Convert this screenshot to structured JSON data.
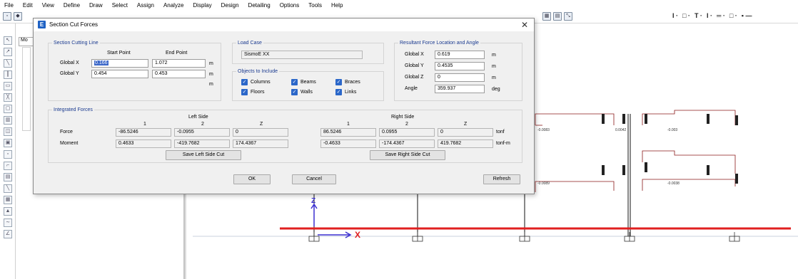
{
  "menu": [
    "File",
    "Edit",
    "View",
    "Define",
    "Draw",
    "Select",
    "Assign",
    "Analyze",
    "Display",
    "Design",
    "Detailing",
    "Options",
    "Tools",
    "Help"
  ],
  "model_tab": "Mo",
  "dialog": {
    "title": "Section Cut Forces",
    "cutting_line": {
      "title": "Section Cutting Line",
      "start_label": "Start Point",
      "end_label": "End Point",
      "gx_label": "Global X",
      "gy_label": "Global Y",
      "gx_start": "0.166",
      "gx_end": "1.072",
      "gy_start": "0.454",
      "gy_end": "0.453",
      "unit_m": "m"
    },
    "load_case": {
      "title": "Load Case",
      "value": "SismoE XX"
    },
    "objects": {
      "title": "Objects to Include",
      "items": [
        "Columns",
        "Beams",
        "Braces",
        "Floors",
        "Walls",
        "Links"
      ]
    },
    "resultant": {
      "title": "Resultant Force Location and Angle",
      "gx_label": "Global X",
      "gy_label": "Global Y",
      "gz_label": "Global Z",
      "angle_label": "Angle",
      "gx": "0.619",
      "gy": "0.4535",
      "gz": "0",
      "angle": "359.937",
      "unit_m": "m",
      "unit_deg": "deg"
    },
    "integrated": {
      "title": "Integrated Forces",
      "left_side": "Left Side",
      "right_side": "Right Side",
      "col1": "1",
      "col2": "2",
      "col3": "Z",
      "force_label": "Force",
      "moment_label": "Moment",
      "left_force": [
        "-86.5246",
        "-0.0955",
        "0"
      ],
      "left_moment": [
        "0.4633",
        "-419.7682",
        "174.4367"
      ],
      "right_force": [
        "86.5246",
        "0.0955",
        "0"
      ],
      "right_moment": [
        "-0.4633",
        "-174.4367",
        "419.7682"
      ],
      "unit_force": "tonf",
      "unit_moment": "tonf-m",
      "save_left": "Save Left Side Cut",
      "save_right": "Save Right Side Cut"
    },
    "ok": "OK",
    "cancel": "Cancel",
    "refresh": "Refresh"
  },
  "drawing": {
    "axis_z": "Z",
    "axis_x": "X",
    "labels": [
      "-0.0083",
      "0.0042",
      "-0.003",
      "-0.0089",
      "-0.0038"
    ],
    "cut_line_color": "#e02020"
  }
}
